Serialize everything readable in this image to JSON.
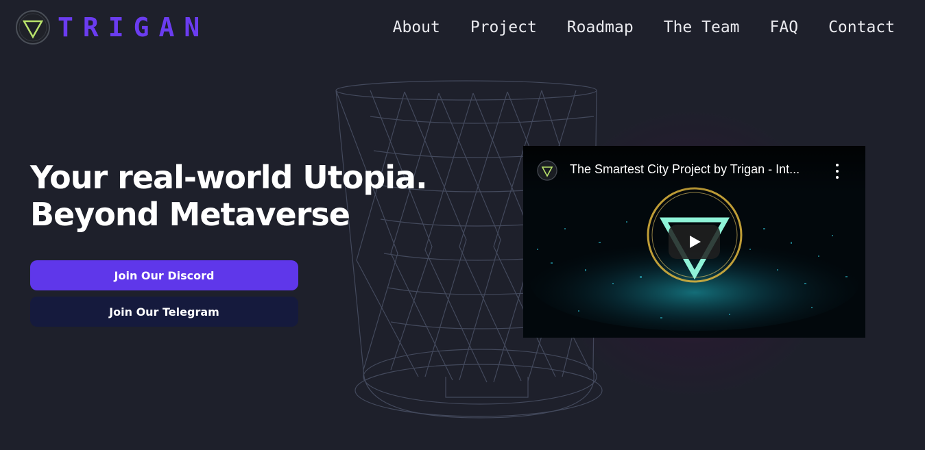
{
  "brand": {
    "name": "TRIGAN",
    "color": "#6b3cf0"
  },
  "nav": [
    "About",
    "Project",
    "Roadmap",
    "The Team",
    "FAQ",
    "Contact"
  ],
  "hero": {
    "line1": "Your real-world Utopia.",
    "line2": "Beyond Metaverse"
  },
  "buttons": {
    "discord": "Join Our Discord",
    "telegram": "Join Our Telegram"
  },
  "video": {
    "title": "The Smartest City Project by Trigan - Int..."
  },
  "colors": {
    "background": "#1e202b",
    "discord_button": "#5f37ea",
    "telegram_button": "#151a3d"
  }
}
